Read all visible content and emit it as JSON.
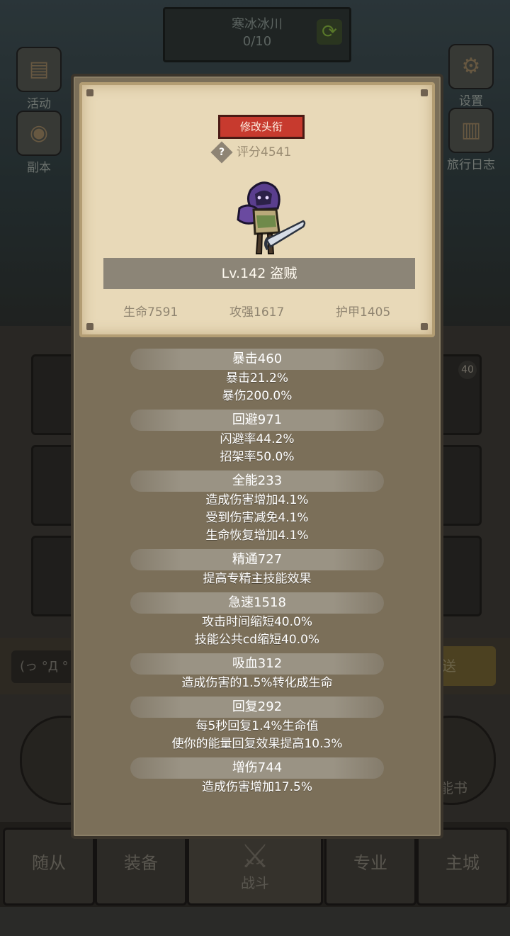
{
  "background": {
    "stage_name": "寒冰冰川",
    "stage_progress": "0/10",
    "left_buttons": [
      {
        "label": "活动",
        "icon": "calendar-icon"
      },
      {
        "label": "副本",
        "icon": "portal-icon"
      }
    ],
    "right_buttons": [
      {
        "label": "设置",
        "icon": "gear-icon"
      },
      {
        "label": "旅行日志",
        "icon": "book-icon"
      }
    ],
    "slot_badge": "40",
    "chat_input": "(っ °Д °",
    "send_label": "送",
    "skillbook_label": "能书",
    "nav": [
      "随从",
      "装备",
      "战斗",
      "专业",
      "主城"
    ]
  },
  "card": {
    "rename_button": "修改头衔",
    "score": "评分4541",
    "name": "Lv.142 盗贼",
    "stats": [
      "生命7591",
      "攻强1617",
      "护甲1405"
    ]
  },
  "attributes": [
    {
      "header": "暴击460",
      "lines": [
        "暴击21.2%",
        "暴伤200.0%"
      ]
    },
    {
      "header": "回避971",
      "lines": [
        "闪避率44.2%",
        "招架率50.0%"
      ]
    },
    {
      "header": "全能233",
      "lines": [
        "造成伤害增加4.1%",
        "受到伤害减免4.1%",
        "生命恢复增加4.1%"
      ]
    },
    {
      "header": "精通727",
      "lines": [
        "提高专精主技能效果"
      ]
    },
    {
      "header": "急速1518",
      "lines": [
        "攻击时间缩短40.0%",
        "技能公共cd缩短40.0%"
      ]
    },
    {
      "header": "吸血312",
      "lines": [
        "造成伤害的1.5%转化成生命"
      ]
    },
    {
      "header": "回复292",
      "lines": [
        "每5秒回复1.4%生命值",
        "使你的能量回复效果提高10.3%"
      ]
    },
    {
      "header": "增伤744",
      "lines": [
        "造成伤害增加17.5%"
      ]
    }
  ],
  "colors": {
    "rename_red": "#c73a2e",
    "parchment": "#e8d9b8",
    "panel_brown": "#7b6f59"
  }
}
